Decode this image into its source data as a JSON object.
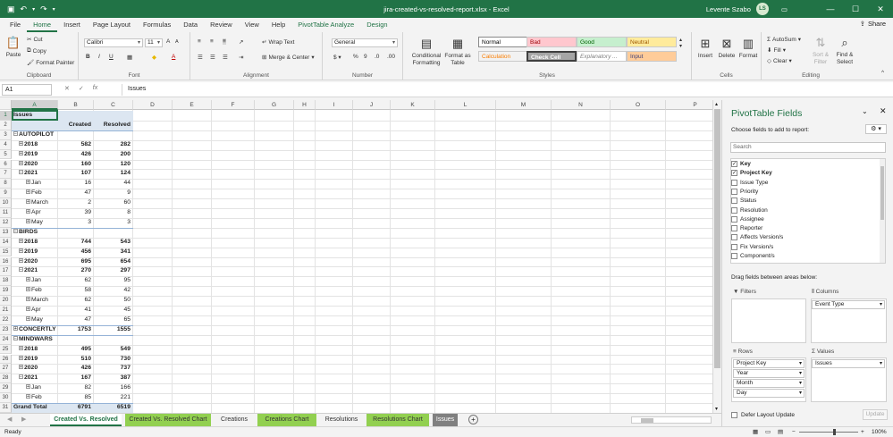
{
  "title_bar": {
    "filename": "jira-created-vs-resolved-report.xlsx",
    "app": "Excel",
    "title": "jira-created-vs-resolved-report.xlsx  -  Excel",
    "user": "Levente Szabo",
    "initials": "LS"
  },
  "menu_tabs": [
    "File",
    "Home",
    "Insert",
    "Page Layout",
    "Formulas",
    "Data",
    "Review",
    "View",
    "Help",
    "PivotTable Analyze",
    "Design"
  ],
  "active_tab": "Home",
  "share_label": "Share",
  "ribbon": {
    "clipboard": {
      "paste": "Paste",
      "cut": "Cut",
      "copy": "Copy",
      "format_painter": "Format Painter",
      "label": "Clipboard"
    },
    "font": {
      "name": "Calibri",
      "size": "11",
      "label": "Font"
    },
    "alignment": {
      "wrap": "Wrap Text",
      "merge": "Merge & Center",
      "label": "Alignment"
    },
    "number": {
      "format": "General",
      "label": "Number"
    },
    "styles": {
      "conditional": "Conditional Formatting",
      "format_table": "Format as Table",
      "cells": [
        {
          "name": "Normal",
          "bg": "#ffffff",
          "fg": "#000000",
          "border": "#888888"
        },
        {
          "name": "Bad",
          "bg": "#ffc7ce",
          "fg": "#9c0006"
        },
        {
          "name": "Good",
          "bg": "#c6efce",
          "fg": "#006100"
        },
        {
          "name": "Neutral",
          "bg": "#ffeb9c",
          "fg": "#9c5700"
        },
        {
          "name": "Calculation",
          "bg": "#f2f2f2",
          "fg": "#fa7d00"
        },
        {
          "name": "Check Cell",
          "bg": "#a5a5a5",
          "fg": "#ffffff"
        },
        {
          "name": "Explanatory ...",
          "bg": "#ffffff",
          "fg": "#7f7f7f"
        },
        {
          "name": "Input",
          "bg": "#ffcc99",
          "fg": "#3f3f76"
        }
      ],
      "label": "Styles"
    },
    "cells_group": {
      "insert": "Insert",
      "delete": "Delete",
      "format": "Format",
      "label": "Cells"
    },
    "editing": {
      "autosum": "AutoSum",
      "fill": "Fill",
      "clear": "Clear",
      "sort_filter": "Sort & Filter",
      "find_select": "Find & Select",
      "label": "Editing"
    }
  },
  "formula_bar": {
    "name_box": "A1",
    "fx": "fx",
    "content": "Issues"
  },
  "columns": [
    "A",
    "B",
    "C",
    "D",
    "E",
    "F",
    "G",
    "H",
    "I",
    "J",
    "K",
    "L",
    "M",
    "N",
    "O",
    "P"
  ],
  "sheet": {
    "header_label": "Issues",
    "col_created": "Created",
    "col_resolved": "Resolved",
    "rows": [
      {
        "n": "1",
        "label": "Issues",
        "created": "",
        "resolved": "",
        "level": 0,
        "kind": "header"
      },
      {
        "n": "2",
        "label": "",
        "created": "Created",
        "resolved": "Resolved",
        "level": 0,
        "kind": "colheads"
      },
      {
        "n": "3",
        "label": "AUTOPILOT",
        "created": "",
        "resolved": "",
        "level": 0,
        "kind": "group"
      },
      {
        "n": "4",
        "label": "2018",
        "created": "582",
        "resolved": "282",
        "level": 1,
        "kind": "year"
      },
      {
        "n": "5",
        "label": "2019",
        "created": "426",
        "resolved": "200",
        "level": 1,
        "kind": "year"
      },
      {
        "n": "6",
        "label": "2020",
        "created": "160",
        "resolved": "120",
        "level": 1,
        "kind": "year"
      },
      {
        "n": "7",
        "label": "2021",
        "created": "107",
        "resolved": "124",
        "level": 1,
        "kind": "yearopen"
      },
      {
        "n": "8",
        "label": "Jan",
        "created": "16",
        "resolved": "44",
        "level": 2,
        "kind": "month"
      },
      {
        "n": "9",
        "label": "Feb",
        "created": "47",
        "resolved": "9",
        "level": 2,
        "kind": "month"
      },
      {
        "n": "10",
        "label": "March",
        "created": "2",
        "resolved": "60",
        "level": 2,
        "kind": "month"
      },
      {
        "n": "11",
        "label": "Apr",
        "created": "39",
        "resolved": "8",
        "level": 2,
        "kind": "month"
      },
      {
        "n": "12",
        "label": "May",
        "created": "3",
        "resolved": "3",
        "level": 2,
        "kind": "month"
      },
      {
        "n": "13",
        "label": "BIRDS",
        "created": "",
        "resolved": "",
        "level": 0,
        "kind": "group"
      },
      {
        "n": "14",
        "label": "2018",
        "created": "744",
        "resolved": "543",
        "level": 1,
        "kind": "year"
      },
      {
        "n": "15",
        "label": "2019",
        "created": "456",
        "resolved": "341",
        "level": 1,
        "kind": "year"
      },
      {
        "n": "16",
        "label": "2020",
        "created": "695",
        "resolved": "654",
        "level": 1,
        "kind": "year"
      },
      {
        "n": "17",
        "label": "2021",
        "created": "270",
        "resolved": "297",
        "level": 1,
        "kind": "yearopen"
      },
      {
        "n": "18",
        "label": "Jan",
        "created": "62",
        "resolved": "95",
        "level": 2,
        "kind": "month"
      },
      {
        "n": "19",
        "label": "Feb",
        "created": "58",
        "resolved": "42",
        "level": 2,
        "kind": "month"
      },
      {
        "n": "20",
        "label": "March",
        "created": "62",
        "resolved": "50",
        "level": 2,
        "kind": "month"
      },
      {
        "n": "21",
        "label": "Apr",
        "created": "41",
        "resolved": "45",
        "level": 2,
        "kind": "month"
      },
      {
        "n": "22",
        "label": "May",
        "created": "47",
        "resolved": "65",
        "level": 2,
        "kind": "month"
      },
      {
        "n": "23",
        "label": "CONCERTLY",
        "created": "1753",
        "resolved": "1555",
        "level": 0,
        "kind": "groupclosed"
      },
      {
        "n": "24",
        "label": "MINDWARS",
        "created": "",
        "resolved": "",
        "level": 0,
        "kind": "group"
      },
      {
        "n": "25",
        "label": "2018",
        "created": "495",
        "resolved": "549",
        "level": 1,
        "kind": "year"
      },
      {
        "n": "26",
        "label": "2019",
        "created": "510",
        "resolved": "730",
        "level": 1,
        "kind": "year"
      },
      {
        "n": "27",
        "label": "2020",
        "created": "426",
        "resolved": "737",
        "level": 1,
        "kind": "year"
      },
      {
        "n": "28",
        "label": "2021",
        "created": "167",
        "resolved": "387",
        "level": 1,
        "kind": "yearopen"
      },
      {
        "n": "29",
        "label": "Jan",
        "created": "82",
        "resolved": "166",
        "level": 2,
        "kind": "month"
      },
      {
        "n": "30",
        "label": "Feb",
        "created": "85",
        "resolved": "221",
        "level": 2,
        "kind": "month"
      },
      {
        "n": "31",
        "label": "Grand Total",
        "created": "6791",
        "resolved": "6519",
        "level": 0,
        "kind": "total"
      }
    ]
  },
  "sheet_tabs": [
    {
      "name": "Created Vs. Resolved",
      "active": true,
      "color": "#ffffff"
    },
    {
      "name": "Created Vs. Resolved Chart",
      "active": false,
      "color": "#92d050"
    },
    {
      "name": "Creations",
      "active": false,
      "color": ""
    },
    {
      "name": "Creations Chart",
      "active": false,
      "color": "#92d050"
    },
    {
      "name": "Resolutions",
      "active": false,
      "color": ""
    },
    {
      "name": "Resolutions Chart",
      "active": false,
      "color": "#92d050"
    },
    {
      "name": "Issues",
      "active": false,
      "color": "#808080"
    }
  ],
  "status": {
    "ready": "Ready",
    "zoom": "100%"
  },
  "pivot_pane": {
    "title": "PivotTable Fields",
    "choose_label": "Choose fields to add to report:",
    "search_placeholder": "Search",
    "fields": [
      {
        "name": "Key",
        "checked": true
      },
      {
        "name": "Project Key",
        "checked": true
      },
      {
        "name": "Issue Type",
        "checked": false
      },
      {
        "name": "Priority",
        "checked": false
      },
      {
        "name": "Status",
        "checked": false
      },
      {
        "name": "Resolution",
        "checked": false
      },
      {
        "name": "Assignee",
        "checked": false
      },
      {
        "name": "Reporter",
        "checked": false
      },
      {
        "name": "Affects Version/s",
        "checked": false
      },
      {
        "name": "Fix Version/s",
        "checked": false
      },
      {
        "name": "Component/s",
        "checked": false
      }
    ],
    "drag_label": "Drag fields between areas below:",
    "filters_label": "Filters",
    "columns_label": "Columns",
    "rows_label": "Rows",
    "values_label": "Values",
    "columns_items": [
      "Event Type"
    ],
    "rows_items": [
      "Project Key",
      "Year",
      "Month",
      "Day"
    ],
    "values_items": [
      "Issues"
    ],
    "defer_label": "Defer Layout Update",
    "update_label": "Update"
  },
  "colors": {
    "excel_green": "#217346",
    "pivot_header": "#dce6f1"
  }
}
